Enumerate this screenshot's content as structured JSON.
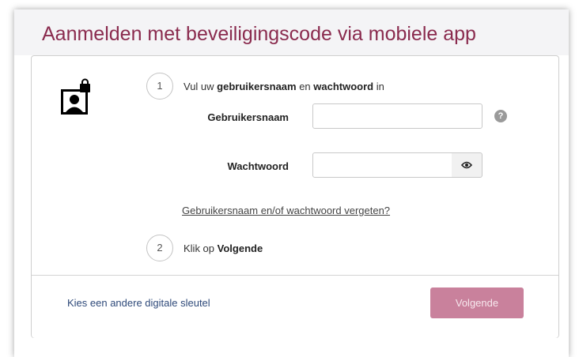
{
  "header": {
    "title": "Aanmelden met beveiligingscode via mobiele app"
  },
  "steps": [
    {
      "number": "1",
      "pre": "Vul uw ",
      "bold1": "gebruikersnaam",
      "mid": " en ",
      "bold2": "wachtwoord",
      "post": " in"
    },
    {
      "number": "2",
      "pre": "Klik op ",
      "bold1": "Volgende"
    }
  ],
  "form": {
    "username_label": "Gebruikersnaam",
    "username_value": "",
    "password_label": "Wachtwoord",
    "password_value": "",
    "help_glyph": "?",
    "forgot_link": "Gebruikersnaam en/of wachtwoord vergeten?"
  },
  "footer": {
    "alt_key_link": "Kies een andere digitale sleutel",
    "next_button": "Volgende"
  },
  "icons": {
    "avatar": "user-lock-icon",
    "help": "question-circle-icon",
    "eye": "eye-icon"
  },
  "colors": {
    "title": "#8a2b4e",
    "button_bg": "#c9819c",
    "link": "#2f4a7a"
  }
}
